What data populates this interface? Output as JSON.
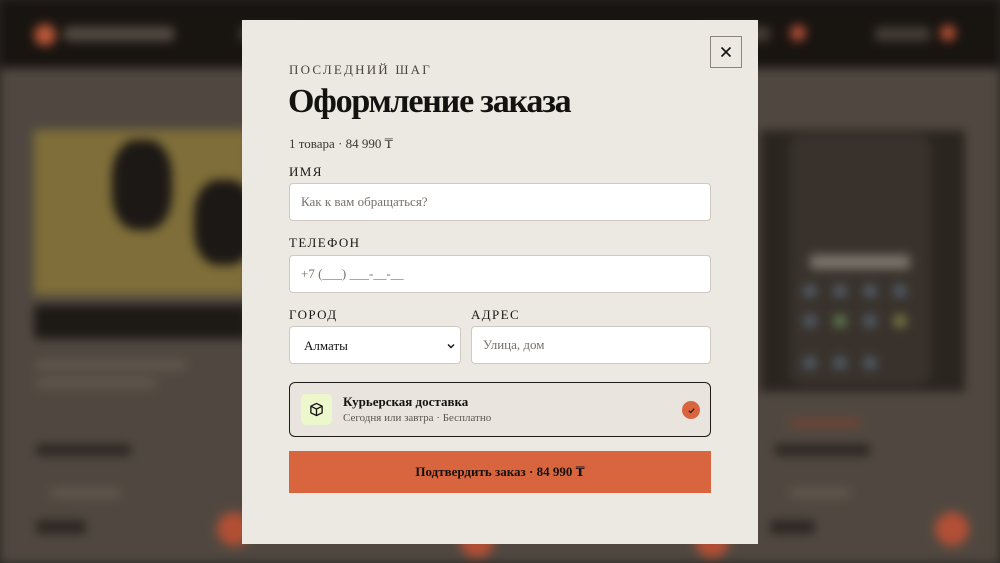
{
  "modal": {
    "eyebrow": "ПОСЛЕДНИЙ ШАГ",
    "title": "Оформление заказа",
    "summary": "1 товара · 84 990 ₸",
    "fields": {
      "name": {
        "label": "ИМЯ",
        "placeholder": "Как к вам обращаться?"
      },
      "phone": {
        "label": "ТЕЛЕФОН",
        "placeholder": "+7 (___) ___-__-__"
      },
      "city": {
        "label": "ГОРОД",
        "value": "Алматы"
      },
      "address": {
        "label": "АДРЕС",
        "placeholder": "Улица, дом"
      }
    },
    "delivery": {
      "title": "Курьерская доставка",
      "subtitle": "Сегодня или завтра · Бесплатно",
      "selected": true,
      "icon": "package-icon"
    },
    "confirm_label": "Подтвердить заказ · 84 990 ₸",
    "close_icon": "close-icon"
  },
  "colors": {
    "accent": "#d9653e",
    "modal_bg": "#ece8e2",
    "delivery_icon_bg": "#ecf7cc",
    "text": "#141210"
  }
}
